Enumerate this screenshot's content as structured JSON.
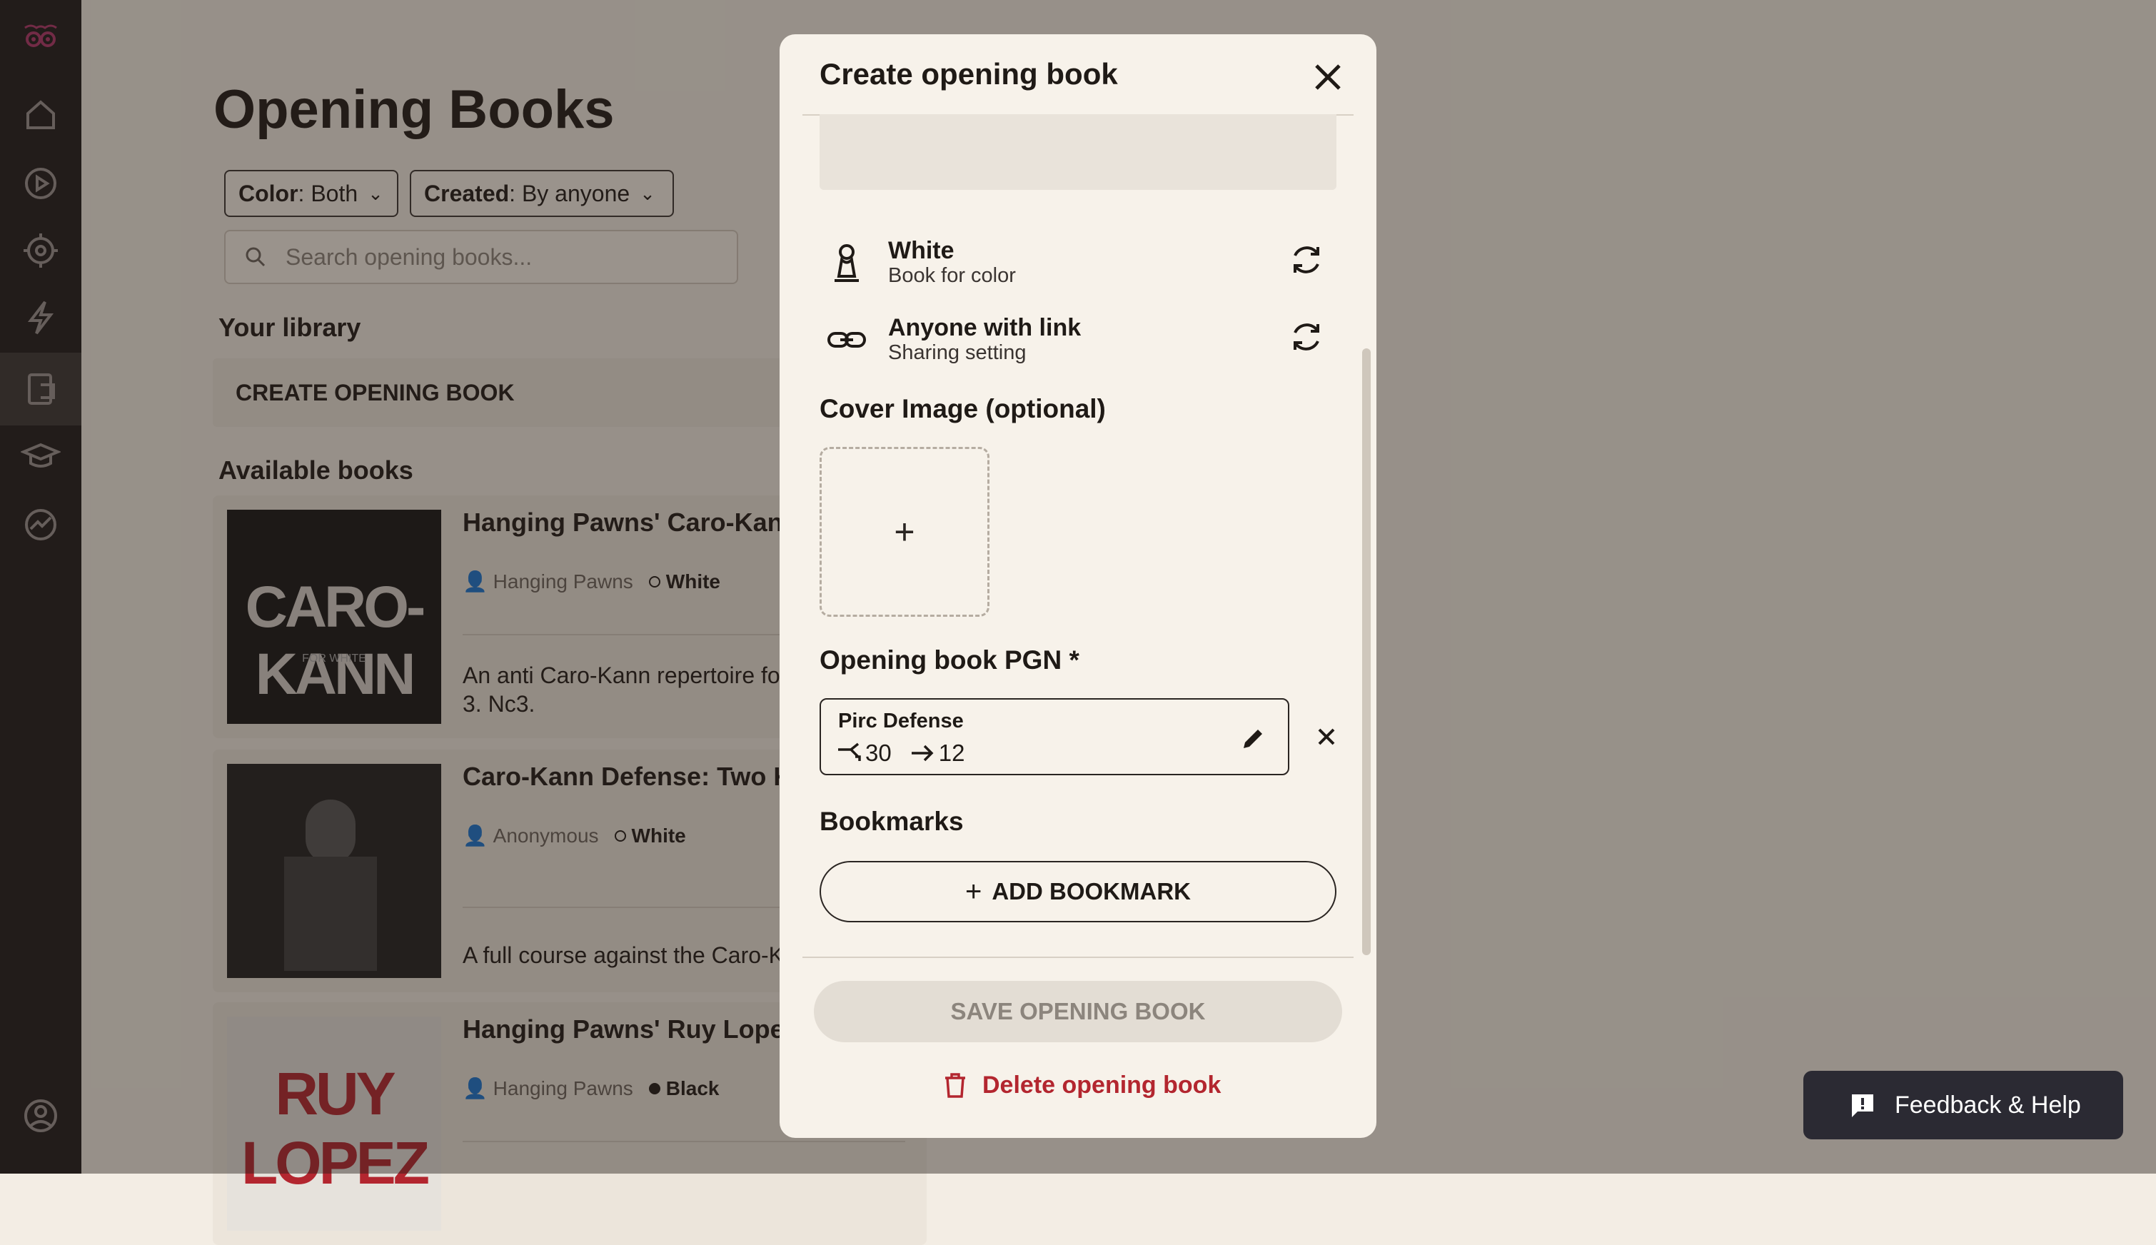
{
  "sidebar": {
    "items": [
      {
        "icon": "home-icon"
      },
      {
        "icon": "play-icon"
      },
      {
        "icon": "target-icon"
      },
      {
        "icon": "lightning-icon"
      },
      {
        "icon": "opening-book-icon",
        "active": true
      },
      {
        "icon": "graduation-cap-icon"
      },
      {
        "icon": "trend-chart-icon"
      },
      {
        "icon": "profile-icon"
      }
    ]
  },
  "page": {
    "title": "Opening Books",
    "filters": [
      {
        "key": "Color",
        "value": ": Both"
      },
      {
        "key": "Created",
        "value": ": By anyone"
      }
    ],
    "search_placeholder": "Search opening books...",
    "your_library": "Your library",
    "create_label": "CREATE OPENING BOOK",
    "available_books": "Available books",
    "books": [
      {
        "title": "Hanging Pawns' Caro-Kann White",
        "author": "Hanging Pawns",
        "color": "White",
        "desc": "An anti Caro-Kann repertoire fo based on 3. Nc3.",
        "cover_text": "CARO-KANN",
        "cover_sub": "FOR WHITE"
      },
      {
        "title": "Caro-Kann Defense: Two K Attack",
        "author": "Anonymous",
        "color": "White",
        "desc": "A full course against the Caro-K"
      },
      {
        "title": "Hanging Pawns' Ruy Lopez Black",
        "author": "Hanging Pawns",
        "color": "Black",
        "cover_text": "RUY LOPEZ"
      }
    ]
  },
  "modal": {
    "title": "Create opening book",
    "settings": [
      {
        "title": "White",
        "subtitle": "Book for color",
        "icon": "pawn-icon"
      },
      {
        "title": "Anyone with link",
        "subtitle": "Sharing setting",
        "icon": "link-icon"
      }
    ],
    "cover_heading": "Cover Image (optional)",
    "upload_symbol": "+",
    "pgn_heading": "Opening book PGN *",
    "pgn": {
      "name": "Pirc Defense",
      "branches": "30",
      "lines": "12"
    },
    "bookmarks_heading": "Bookmarks",
    "add_bookmark": "ADD BOOKMARK",
    "save_label": "SAVE OPENING BOOK",
    "delete_label": "Delete opening book"
  },
  "feedback": {
    "label": "Feedback & Help"
  },
  "colors": {
    "accent": "#b3262f",
    "sidebar": "#1e1b1a",
    "brand": "#b0356a"
  }
}
